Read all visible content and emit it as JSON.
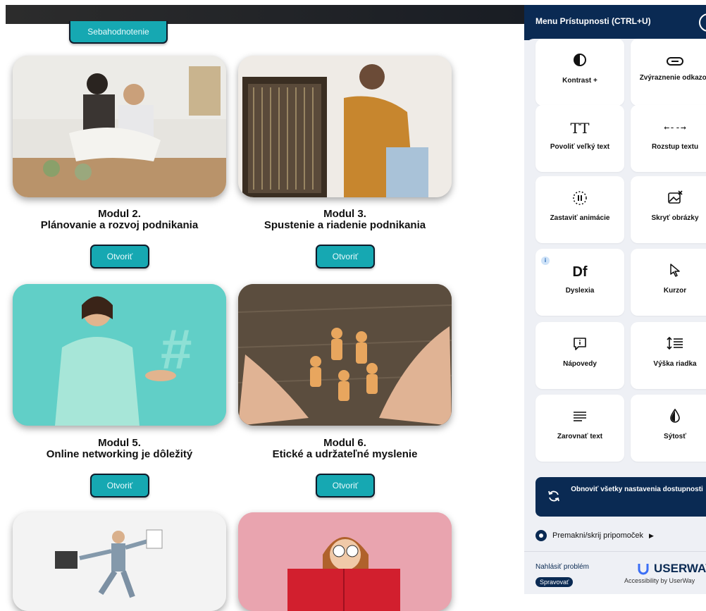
{
  "top": {
    "self_assessment_label": "Sebahodnotenie"
  },
  "modules": [
    {
      "num": "Modul 2.",
      "title": "Plánovanie a rozvoj podnikania",
      "button": "Otvoriť"
    },
    {
      "num": "Modul 3.",
      "title": "Spustenie a riadenie podnikania",
      "button": "Otvoriť"
    },
    {
      "num": "Modul 5.",
      "title": "Online networking je dôležitý",
      "button": "Otvoriť"
    },
    {
      "num": "Modul 6.",
      "title": "Etické a udržateľné myslenie",
      "button": "Otvoriť"
    }
  ],
  "accessibility": {
    "header": "Menu Prístupnosti (CTRL+U)",
    "tiles": [
      {
        "label": "Kontrast +",
        "icon": "contrast-icon"
      },
      {
        "label": "Zvýraznenie odkazov",
        "icon": "link-icon"
      },
      {
        "label": "Povoliť veľký text",
        "icon": "text-size-icon",
        "glyph": "TT"
      },
      {
        "label": "Rozstup textu",
        "icon": "text-spacing-icon",
        "glyph": "←--→"
      },
      {
        "label": "Zastaviť animácie",
        "icon": "pause-animation-icon"
      },
      {
        "label": "Skryť obrázky",
        "icon": "hide-images-icon"
      },
      {
        "label": "Dyslexia",
        "icon": "dyslexia-icon",
        "glyph": "Df"
      },
      {
        "label": "Kurzor",
        "icon": "cursor-icon"
      },
      {
        "label": "Nápovedy",
        "icon": "tooltip-icon"
      },
      {
        "label": "Výška riadka",
        "icon": "line-height-icon"
      },
      {
        "label": "Zarovnať text",
        "icon": "align-text-icon"
      },
      {
        "label": "Sýtosť",
        "icon": "saturation-icon"
      }
    ],
    "info_badge": "i",
    "reset_label": "Obnoviť všetky nastavenia dostupnosti",
    "move_label": "Premakni/skrij pripomoček",
    "report_label": "Nahlásiť problém",
    "manage_label": "Spravovať",
    "brand": "USERWAY",
    "brand_sub": "Accessibility by UserWay"
  },
  "colors": {
    "teal": "#16a8b2",
    "navy": "#0a2a53",
    "panel_bg": "#eef0f5"
  }
}
